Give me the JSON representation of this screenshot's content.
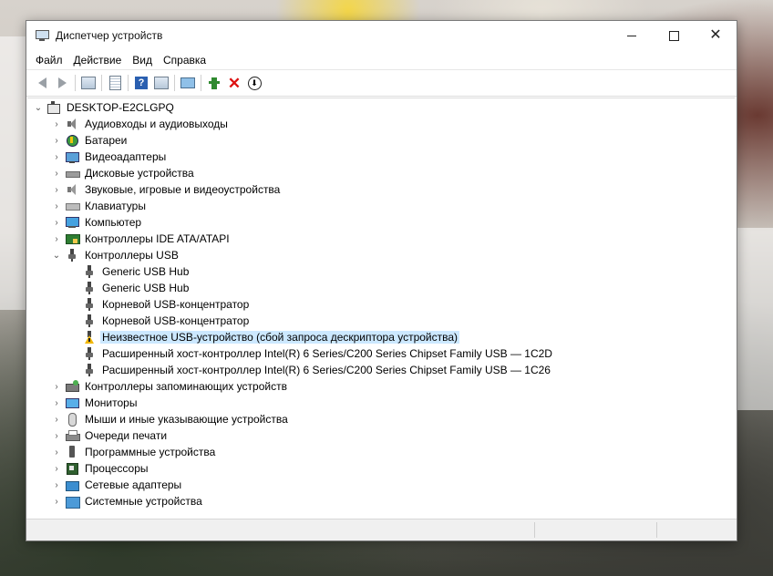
{
  "window": {
    "title": "Диспетчер устройств",
    "controls": {
      "minimize": "—",
      "maximize": "☐",
      "close": "✕"
    }
  },
  "menu": [
    "Файл",
    "Действие",
    "Вид",
    "Справка"
  ],
  "toolbar": {
    "icons": [
      "back-icon",
      "forward-icon",
      "properties-icon",
      "doc-icon",
      "help-icon",
      "view-icon",
      "monitor-icon",
      "add-driver-icon",
      "uninstall-icon",
      "update-driver-icon"
    ]
  },
  "tree": {
    "root": "DESKTOP-E2CLGPQ",
    "categories": [
      "Аудиовходы и аудиовыходы",
      "Батареи",
      "Видеоадаптеры",
      "Дисковые устройства",
      "Звуковые, игровые и видеоустройства",
      "Клавиатуры",
      "Компьютер",
      "Контроллеры IDE ATA/ATAPI",
      "Контроллеры USB"
    ],
    "usb_children": [
      "Generic USB Hub",
      "Generic USB Hub",
      "Корневой USB-концентратор",
      "Корневой USB-концентратор",
      "Неизвестное USB-устройство (сбой запроса дескриптора устройства)",
      "Расширенный хост-контроллер Intel(R) 6 Series/C200 Series Chipset Family USB — 1C2D",
      "Расширенный хост-контроллер Intel(R) 6 Series/C200 Series Chipset Family USB — 1C26"
    ],
    "categories_after": [
      "Контроллеры запоминающих устройств",
      "Мониторы",
      "Мыши и иные указывающие устройства",
      "Очереди печати",
      "Программные устройства",
      "Процессоры",
      "Сетевые адаптеры",
      "Системные устройства"
    ]
  },
  "colors": {
    "selection": "#cce8ff",
    "warning": "#f2b705",
    "uninstall": "#dd1111"
  }
}
